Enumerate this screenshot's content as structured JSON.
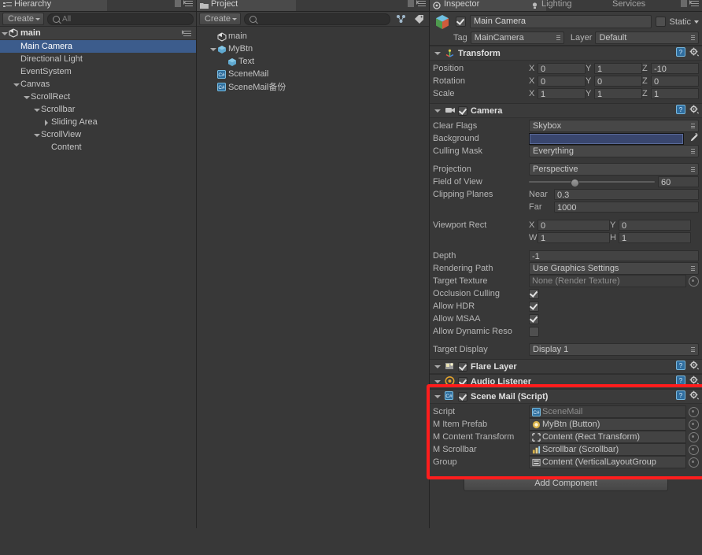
{
  "hierarchy": {
    "tab_label": "Hierarchy",
    "create_label": "Create",
    "search_placeholder": "All",
    "scene_name": "main",
    "items": [
      {
        "label": "Main Camera",
        "indent": 1,
        "twisty": "none",
        "icon": "gameobject-icon",
        "selected": true
      },
      {
        "label": "Directional Light",
        "indent": 1,
        "twisty": "none",
        "icon": "gameobject-icon",
        "selected": false
      },
      {
        "label": "EventSystem",
        "indent": 1,
        "twisty": "none",
        "icon": "gameobject-icon",
        "selected": false
      },
      {
        "label": "Canvas",
        "indent": 1,
        "twisty": "down",
        "icon": "gameobject-icon",
        "selected": false
      },
      {
        "label": "ScrollRect",
        "indent": 2,
        "twisty": "down",
        "icon": "gameobject-icon",
        "selected": false
      },
      {
        "label": "Scrollbar",
        "indent": 3,
        "twisty": "down",
        "icon": "gameobject-icon",
        "selected": false
      },
      {
        "label": "Sliding Area",
        "indent": 4,
        "twisty": "right",
        "icon": "gameobject-icon",
        "selected": false
      },
      {
        "label": "ScrollView",
        "indent": 3,
        "twisty": "down",
        "icon": "gameobject-icon",
        "selected": false
      },
      {
        "label": "Content",
        "indent": 4,
        "twisty": "none",
        "icon": "gameobject-icon",
        "selected": false
      }
    ]
  },
  "project": {
    "tab_label": "Project",
    "create_label": "Create",
    "search_placeholder": "",
    "items": [
      {
        "label": "main",
        "indent": 1,
        "twisty": "none",
        "icon": "unity-scene-icon"
      },
      {
        "label": "MyBtn",
        "indent": 1,
        "twisty": "down",
        "icon": "prefab-icon"
      },
      {
        "label": "Text",
        "indent": 2,
        "twisty": "none",
        "icon": "prefab-icon"
      },
      {
        "label": "SceneMail",
        "indent": 1,
        "twisty": "none",
        "icon": "csharp-script-icon"
      },
      {
        "label": "SceneMail备份",
        "indent": 1,
        "twisty": "none",
        "icon": "csharp-script-icon"
      }
    ]
  },
  "inspector": {
    "tabs": [
      {
        "label": "Inspector",
        "icon": "inspector-icon",
        "active": true
      },
      {
        "label": "Lighting",
        "icon": "lighting-icon",
        "active": false
      },
      {
        "label": "Services",
        "icon": "services-icon",
        "active": false
      }
    ],
    "object": {
      "enabled": true,
      "name": "Main Camera",
      "static_label": "Static",
      "static_checked": false,
      "tag_label": "Tag",
      "tag_value": "MainCamera",
      "layer_label": "Layer",
      "layer_value": "Default"
    },
    "components": [
      {
        "name": "Transform",
        "icon": "transform-icon",
        "has_checkbox": false,
        "rows": [
          {
            "type": "vec3",
            "label": "Position",
            "x": "0",
            "y": "1",
            "z": "-10"
          },
          {
            "type": "vec3",
            "label": "Rotation",
            "x": "0",
            "y": "0",
            "z": "0"
          },
          {
            "type": "vec3",
            "label": "Scale",
            "x": "1",
            "y": "1",
            "z": "1"
          }
        ]
      },
      {
        "name": "Camera",
        "icon": "camera-icon",
        "has_checkbox": true,
        "enabled": true,
        "rows": [
          {
            "type": "dropdown",
            "label": "Clear Flags",
            "value": "Skybox"
          },
          {
            "type": "color",
            "label": "Background",
            "value": "#39466e"
          },
          {
            "type": "dropdown",
            "label": "Culling Mask",
            "value": "Everything"
          },
          {
            "type": "spacer"
          },
          {
            "type": "dropdown",
            "label": "Projection",
            "value": "Perspective"
          },
          {
            "type": "slider",
            "label": "Field of View",
            "value": "60",
            "pct": 33
          },
          {
            "type": "pair",
            "label": "Clipping Planes",
            "k1": "Near",
            "v1": "0.3"
          },
          {
            "type": "pair",
            "label": "",
            "k1": "Far",
            "v1": "1000"
          },
          {
            "type": "spacer"
          },
          {
            "type": "vec2",
            "label": "Viewport Rect",
            "ka": "X",
            "va": "0",
            "kb": "Y",
            "vb": "0"
          },
          {
            "type": "vec2",
            "label": "",
            "ka": "W",
            "va": "1",
            "kb": "H",
            "vb": "1"
          },
          {
            "type": "spacer"
          },
          {
            "type": "text",
            "label": "Depth",
            "value": "-1"
          },
          {
            "type": "dropdown",
            "label": "Rendering Path",
            "value": "Use Graphics Settings"
          },
          {
            "type": "object",
            "label": "Target Texture",
            "value": "None (Render Texture)",
            "icon": "none-icon",
            "dim": true
          },
          {
            "type": "check",
            "label": "Occlusion Culling",
            "checked": true
          },
          {
            "type": "check",
            "label": "Allow HDR",
            "checked": true
          },
          {
            "type": "check",
            "label": "Allow MSAA",
            "checked": true
          },
          {
            "type": "check",
            "label": "Allow Dynamic Reso",
            "checked": false
          },
          {
            "type": "spacer"
          },
          {
            "type": "dropdown",
            "label": "Target Display",
            "value": "Display 1"
          }
        ]
      },
      {
        "name": "Flare Layer",
        "icon": "flare-layer-icon",
        "has_checkbox": true,
        "enabled": true,
        "rows": []
      },
      {
        "name": "Audio Listener",
        "icon": "audio-listener-icon",
        "has_checkbox": true,
        "enabled": true,
        "rows": []
      },
      {
        "name": "Scene Mail (Script)",
        "icon": "csharp-script-icon",
        "has_checkbox": true,
        "enabled": true,
        "highlighted": true,
        "rows": [
          {
            "type": "object",
            "label": "Script",
            "value": "SceneMail",
            "icon": "csharp-script-icon",
            "dim": true
          },
          {
            "type": "object",
            "label": "M Item Prefab",
            "value": "MyBtn (Button)",
            "icon": "button-icon",
            "dim": false
          },
          {
            "type": "object",
            "label": "M Content Transform",
            "value": "Content (Rect Transform)",
            "icon": "rect-transform-icon",
            "dim": false
          },
          {
            "type": "object",
            "label": "M Scrollbar",
            "value": "Scrollbar (Scrollbar)",
            "icon": "scrollbar-icon",
            "dim": false
          },
          {
            "type": "object",
            "label": "Group",
            "value": "Content (VerticalLayoutGroup",
            "icon": "layout-group-icon",
            "dim": false
          }
        ]
      }
    ],
    "add_component_label": "Add Component"
  },
  "colors": {
    "panel_bg": "#383838",
    "selection_blue": "#3c5c8c",
    "highlight_red": "#ff1d1d",
    "background_swatch": "#39466e"
  }
}
